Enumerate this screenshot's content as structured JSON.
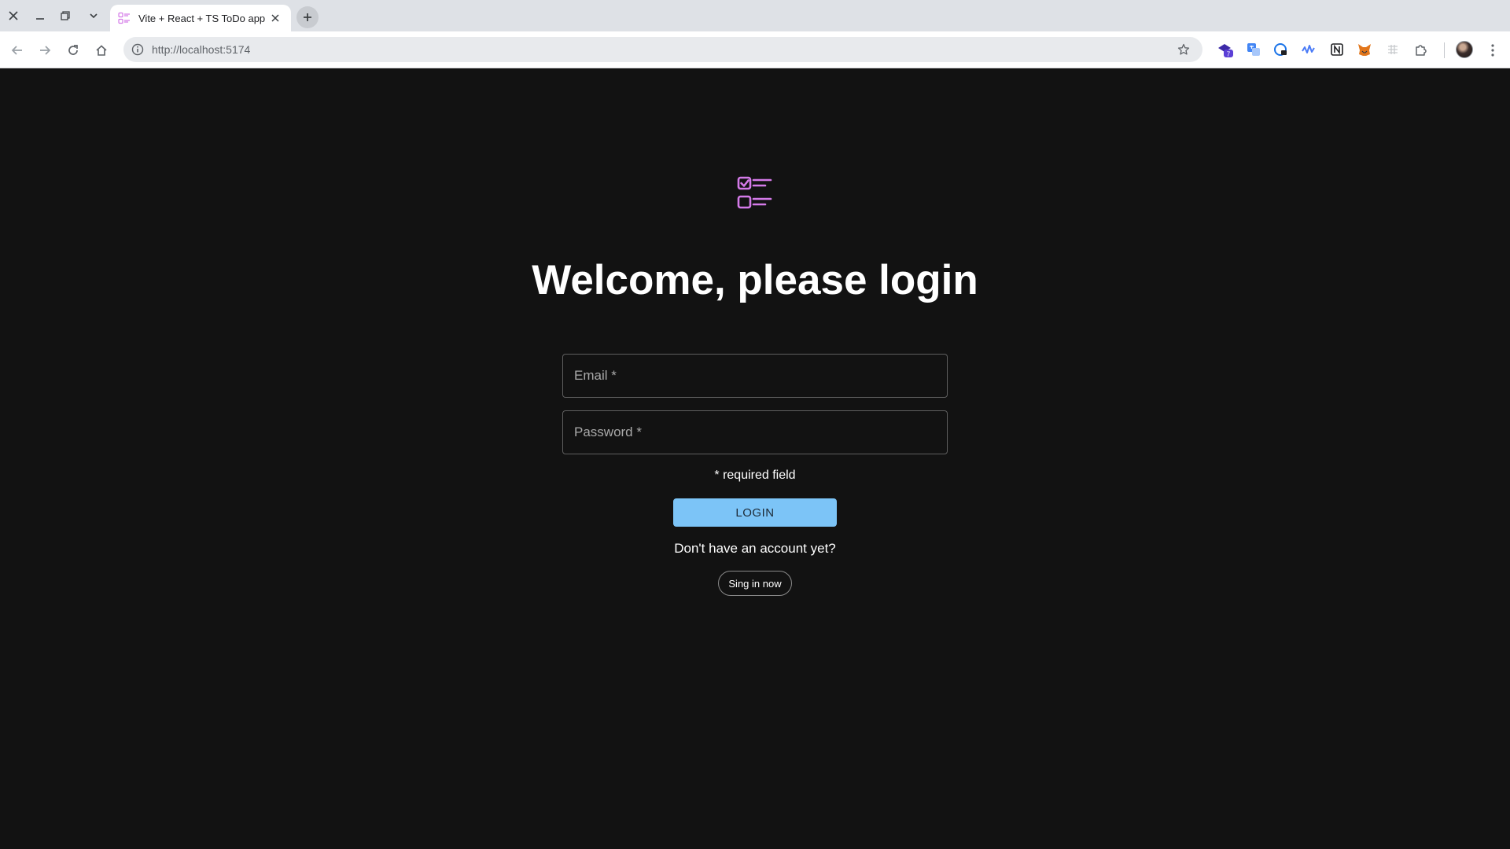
{
  "browser": {
    "tab_title": "Vite + React + TS ToDo app",
    "url": "http://localhost:5174",
    "extensions": [
      {
        "name": "shield-extension-icon",
        "badge": "7"
      },
      {
        "name": "translate-extension-icon"
      },
      {
        "name": "password-extension-icon"
      },
      {
        "name": "wave-extension-icon"
      },
      {
        "name": "notion-extension-icon"
      },
      {
        "name": "metamask-fox-icon"
      },
      {
        "name": "puzzle-extensions-icon"
      }
    ]
  },
  "login": {
    "title": "Welcome, please login",
    "email_label": "Email *",
    "password_label": "Password *",
    "required_note": "* required field",
    "login_button": "LOGIN",
    "no_account_text": "Don't have an account yet?",
    "signin_button": "Sing in now"
  },
  "colors": {
    "background": "#121212",
    "accent_logo": "#d47ae8",
    "login_button": "#7cc4f7"
  }
}
